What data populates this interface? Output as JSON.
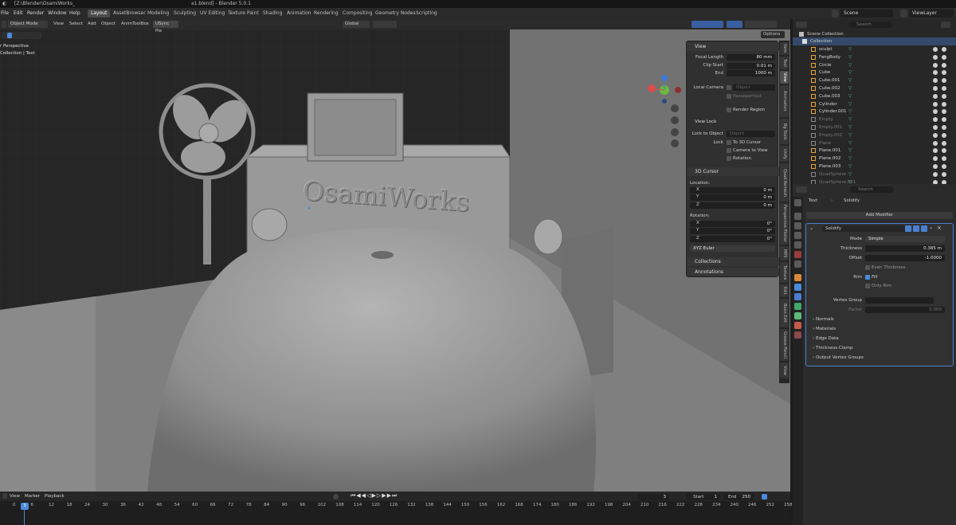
{
  "titlebar": {
    "path": "[Z:\\Blender\\OsamiWorks_",
    "title": "a1.blend] - Blender 5.0.1"
  },
  "menu": [
    "File",
    "Edit",
    "Render",
    "Window",
    "Help"
  ],
  "workspaces": [
    "Layout",
    "AssetBrowser",
    "Modeling",
    "Sculpting",
    "UV Editing",
    "Texture Paint",
    "Shading",
    "Animation",
    "Rendering",
    "Compositing",
    "Geometry Nodes",
    "Scripting"
  ],
  "active_workspace": "Layout",
  "scene": {
    "name": "Scene",
    "view_layer": "ViewLayer"
  },
  "viewport_header": {
    "mode": "Object Mode",
    "items": [
      "View",
      "Select",
      "Add",
      "Object",
      "AnimToolBox",
      "USync Pie"
    ],
    "transform": "Global",
    "options": "Options"
  },
  "viewport": {
    "overlay_title": "r Perspective",
    "overlay_sub": "Collection | Text",
    "scene_text": "OsamiWorks"
  },
  "npanel": {
    "view": {
      "header": "View",
      "focal_length_label": "Focal Length",
      "focal_length": "80 mm",
      "clip_start_label": "Clip Start",
      "clip_start": "0.01 m",
      "end_label": "End",
      "end": "1000 m",
      "local_camera_label": "Local Camera",
      "local_camera_placeholder": "Object",
      "passepartout": "Passepartout",
      "render_region": "Render Region",
      "view_lock_header": "View Lock",
      "lock_to_object_label": "Lock to Object",
      "lock_to_object_placeholder": "Object",
      "lock_label": "Lock",
      "to_3d_cursor": "To 3D Cursor",
      "camera_to_view": "Camera to View",
      "rotation": "Rotation"
    },
    "cursor": {
      "header": "3D Cursor",
      "location_label": "Location:",
      "x": "0 m",
      "y": "0 m",
      "z": "0 m",
      "rotation_label": "Rotation:",
      "rx": "0°",
      "ry": "0°",
      "rz": "0°",
      "mode": "XYZ Euler"
    },
    "collections": "Collections",
    "annotations": "Annotations"
  },
  "vtabs": [
    "Item",
    "Tool",
    "View",
    "Animation",
    "Bg Tools",
    "Unify",
    "Quad Remesh",
    "Perspective Plotter",
    "MPS",
    "Texture",
    "Edit",
    "Boon Edit",
    "Grease Pencil",
    "Vlow"
  ],
  "active_vtab": "View",
  "outliner": {
    "search_placeholder": "Search",
    "scene_collection": "Scene Collection",
    "collection": "Collection",
    "objects": [
      {
        "name": "sculpt",
        "color": "#e8a23c",
        "dim": false
      },
      {
        "name": "FangBody",
        "color": "#e8a23c",
        "dim": false
      },
      {
        "name": "Circle",
        "color": "#e8a23c",
        "dim": false
      },
      {
        "name": "Cube",
        "color": "#e8a23c",
        "dim": false
      },
      {
        "name": "Cube.001",
        "color": "#e8a23c",
        "dim": false
      },
      {
        "name": "Cube.002",
        "color": "#e8a23c",
        "dim": false
      },
      {
        "name": "Cube.003",
        "color": "#e8a23c",
        "dim": false
      },
      {
        "name": "Cylinder",
        "color": "#e8a23c",
        "dim": false
      },
      {
        "name": "Cylinder.001",
        "color": "#e8a23c",
        "dim": false
      },
      {
        "name": "Empty",
        "color": "#888888",
        "dim": true
      },
      {
        "name": "Empty.001",
        "color": "#888888",
        "dim": true
      },
      {
        "name": "Empty.002",
        "color": "#888888",
        "dim": true
      },
      {
        "name": "Plane",
        "color": "#888888",
        "dim": true
      },
      {
        "name": "Plane.001",
        "color": "#e8a23c",
        "dim": false
      },
      {
        "name": "Plane.002",
        "color": "#e8a23c",
        "dim": false
      },
      {
        "name": "Plane.003",
        "color": "#e8a23c",
        "dim": false
      },
      {
        "name": "QuadSphere",
        "color": "#888888",
        "dim": true
      },
      {
        "name": "QuadSphere.001",
        "color": "#888888",
        "dim": true
      }
    ]
  },
  "properties": {
    "search_placeholder": "Search",
    "breadcrumb_object": "Text",
    "breadcrumb_modifier": "Solidify",
    "add_modifier": "Add Modifier",
    "modifier_name": "Solidify",
    "mode_label": "Mode",
    "mode": "Simple",
    "thickness_label": "Thickness",
    "thickness": "0.385 m",
    "offset_label": "Offset",
    "offset": "-1.0000",
    "even_thickness": "Even Thickness",
    "rim_label": "Rim",
    "fill": "Fill",
    "only_rim": "Only Rim",
    "vertex_group_label": "Vertex Group",
    "factor_label": "Factor",
    "factor": "0.000",
    "sections": [
      "Normals",
      "Materials",
      "Edge Data",
      "Thickness Clamp",
      "Output Vertex Groups"
    ]
  },
  "timeline": {
    "menu": [
      "View",
      "Marker",
      "Playback"
    ],
    "current_frame": "3",
    "start_label": "Start",
    "start": "1",
    "end_label": "End",
    "end": "250",
    "ticks": [
      "0",
      "6",
      "12",
      "18",
      "24",
      "30",
      "36",
      "42",
      "48",
      "54",
      "60",
      "66",
      "72",
      "78",
      "84",
      "90",
      "96",
      "102",
      "108",
      "114",
      "120",
      "126",
      "132",
      "138",
      "144",
      "150",
      "156",
      "162",
      "168",
      "174",
      "180",
      "186",
      "192",
      "198",
      "204",
      "210",
      "216",
      "222",
      "228",
      "234",
      "240",
      "246",
      "252",
      "258"
    ]
  },
  "colors": {
    "accent": "#4a8ad8",
    "object_orange": "#e8a23c",
    "modifier_blue": "#5b8fe0",
    "panel_bg": "#303030"
  }
}
